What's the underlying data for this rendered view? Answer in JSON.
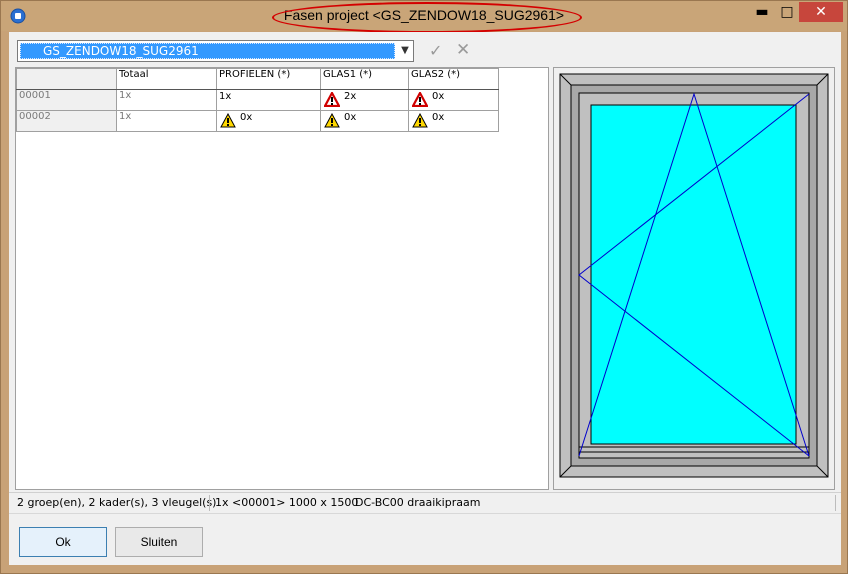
{
  "window": {
    "title": "Fasen project <GS_ZENDOW18_SUG2961>",
    "minimize_glyph": "▬",
    "maximize_glyph": "□",
    "close_glyph": "✕"
  },
  "toolbar": {
    "project_selected": "GS_ZENDOW18_SUG2961",
    "confirm_icon": "check-icon",
    "cancel_icon": "close-icon"
  },
  "grid": {
    "columns": [
      "",
      "Totaal",
      "PROFIELEN (*)",
      "GLAS1 (*)",
      "GLAS2 (*)"
    ],
    "rows": [
      {
        "id": "00001",
        "totaal": "1x",
        "profielen": {
          "value": "1x",
          "status": "none"
        },
        "glas1": {
          "value": "2x",
          "status": "error"
        },
        "glas2": {
          "value": "0x",
          "status": "error"
        }
      },
      {
        "id": "00002",
        "totaal": "1x",
        "profielen": {
          "value": "0x",
          "status": "warning"
        },
        "glas1": {
          "value": "0x",
          "status": "warning"
        },
        "glas2": {
          "value": "0x",
          "status": "warning"
        }
      }
    ]
  },
  "status": {
    "groups": "2 groep(en), 2 kader(s), 3 vleugel(s)",
    "selection": "1x <00001> 1000 x 1500",
    "type": "DC-BC00 draaikipraam"
  },
  "buttons": {
    "ok": "Ok",
    "close": "Sluiten"
  },
  "colors": {
    "title_highlight": "#d40000",
    "glass": "#00ffff",
    "frame": "#c0c0c0",
    "sash_lines": "#0000cc",
    "selection": "#3399ff",
    "error": "#d00000",
    "warning": "#ffd800"
  }
}
